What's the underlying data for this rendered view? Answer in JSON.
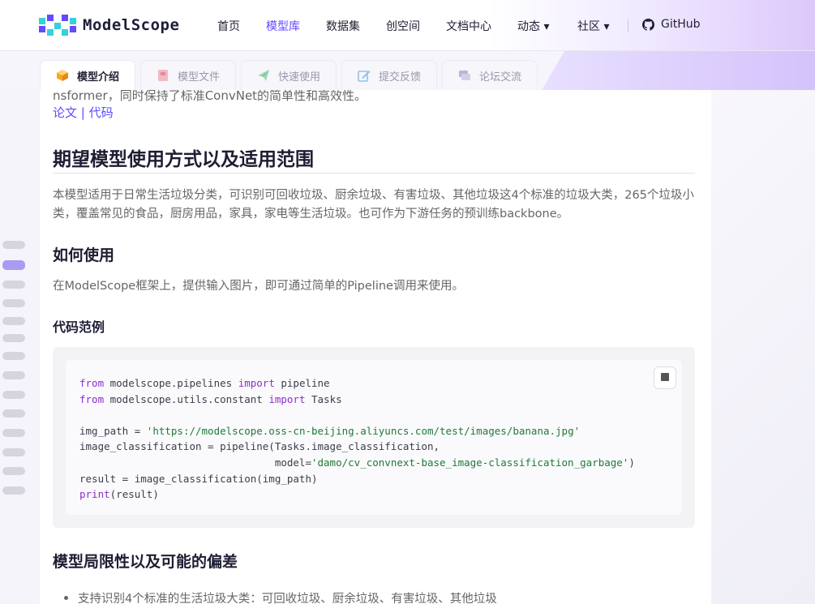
{
  "nav": {
    "brand": "ModelScope",
    "items": [
      {
        "label": "首页",
        "active": false
      },
      {
        "label": "模型库",
        "active": true
      },
      {
        "label": "数据集",
        "active": false
      },
      {
        "label": "创空间",
        "active": false
      },
      {
        "label": "文档中心",
        "active": false
      },
      {
        "label": "动态 ▾",
        "active": false
      },
      {
        "label": "社区 ▾",
        "active": false
      }
    ],
    "github": "GitHub"
  },
  "tabs": [
    {
      "label": "模型介绍",
      "icon": "cube-icon",
      "active": true
    },
    {
      "label": "模型文件",
      "icon": "file-icon",
      "active": false
    },
    {
      "label": "快速使用",
      "icon": "send-icon",
      "active": false
    },
    {
      "label": "提交反馈",
      "icon": "edit-icon",
      "active": false
    },
    {
      "label": "论坛交流",
      "icon": "chat-icon",
      "active": false
    }
  ],
  "content": {
    "truncated_line": "nsformer，同时保持了标准ConvNet的简单性和高效性。",
    "links": {
      "paper": "论文",
      "sep": " | ",
      "code": "代码"
    },
    "section_usage_scope": {
      "title": "期望模型使用方式以及适用范围",
      "paragraph": "本模型适用于日常生活垃圾分类，可识别可回收垃圾、厨余垃圾、有害垃圾、其他垃圾这4个标准的垃圾大类，265个垃圾小类，覆盖常见的食品，厨房用品，家具，家电等生活垃圾。也可作为下游任务的预训练backbone。"
    },
    "section_how_to_use": {
      "title": "如何使用",
      "paragraph": "在ModelScope框架上，提供输入图片，即可通过简单的Pipeline调用来使用。"
    },
    "section_code_example": {
      "title": "代码范例",
      "lines": [
        {
          "kw": "from",
          "a": " modelscope.pipelines ",
          "kw2": "import",
          "b": " pipeline"
        },
        {
          "kw": "from",
          "a": " modelscope.utils.constant ",
          "kw2": "import",
          "b": " Tasks"
        },
        {
          "text": ""
        },
        {
          "pre": "img_path = ",
          "str": "'https://modelscope.oss-cn-beijing.aliyuncs.com/test/images/banana.jpg'"
        },
        {
          "text": "image_classification = pipeline(Tasks.image_classification,"
        },
        {
          "pre": "                                model=",
          "str": "'damo/cv_convnext-base_image-classification_garbage'",
          "post": ")"
        },
        {
          "text": "result = image_classification(img_path)"
        },
        {
          "kw": "print",
          "a": "(result)"
        }
      ]
    },
    "section_limitations": {
      "title": "模型局限性以及可能的偏差",
      "bullet": "支持识别4个标准的生活垃圾大类：可回收垃圾、厨余垃圾、有害垃圾、其他垃圾"
    }
  },
  "outline_pills": {
    "count": 14,
    "active_index": 1
  }
}
